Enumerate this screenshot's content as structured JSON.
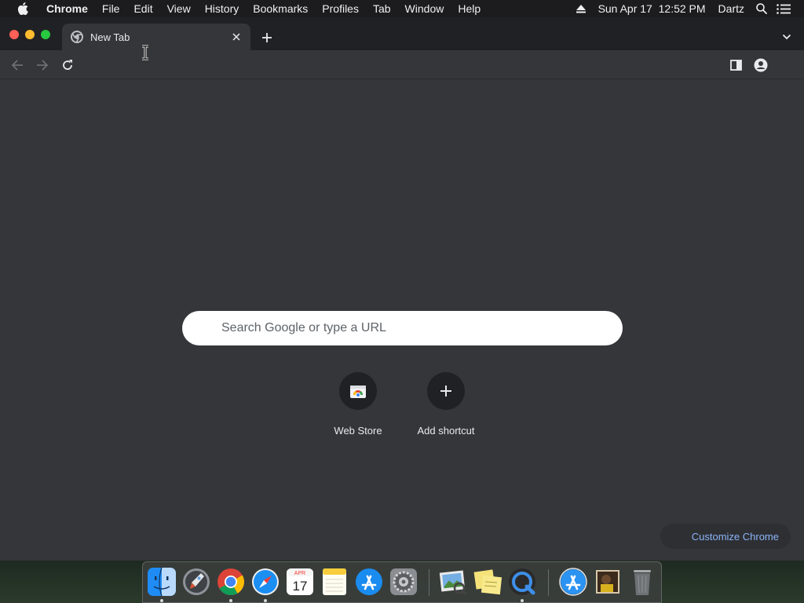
{
  "menubar": {
    "apple_icon": "apple-logo-icon",
    "app_name": "Chrome",
    "menus": [
      "File",
      "Edit",
      "View",
      "History",
      "Bookmarks",
      "Profiles",
      "Tab",
      "Window",
      "Help"
    ],
    "datetime": "Sun Apr 17  12:52 PM",
    "user": "Dartz"
  },
  "browser": {
    "tab": {
      "title": "New Tab",
      "favicon": "chrome-icon"
    },
    "new_tab_icon": "plus-icon",
    "tab_search_icon": "chevron-down-icon"
  },
  "toolbar": {
    "back_icon": "back-arrow-icon",
    "forward_icon": "forward-arrow-icon",
    "reload_icon": "reload-icon",
    "side_panel_icon": "side-panel-icon",
    "profile_icon": "profile-icon"
  },
  "newtab": {
    "search_placeholder": "Search Google or type a URL",
    "shortcuts": [
      {
        "label": "Web Store",
        "icon": "web-store-icon"
      },
      {
        "label": "Add shortcut",
        "icon": "plus-icon"
      }
    ],
    "customize_label": "Customize Chrome"
  },
  "dock": {
    "items": [
      "Finder",
      "Launchpad",
      "Google Chrome",
      "Safari",
      "Calendar",
      "Notes",
      "App Store",
      "System Preferences",
      "Preview",
      "Stickies",
      "QuickTime Player",
      "Downloads",
      "Photo Stack",
      "Trash"
    ],
    "calendar_month": "APR",
    "calendar_day": "17"
  },
  "colors": {
    "window_bg": "#35363a",
    "tabstrip_bg": "#202124",
    "accent_link": "#8ab4f8",
    "searchbox_bg": "#ffffff"
  }
}
